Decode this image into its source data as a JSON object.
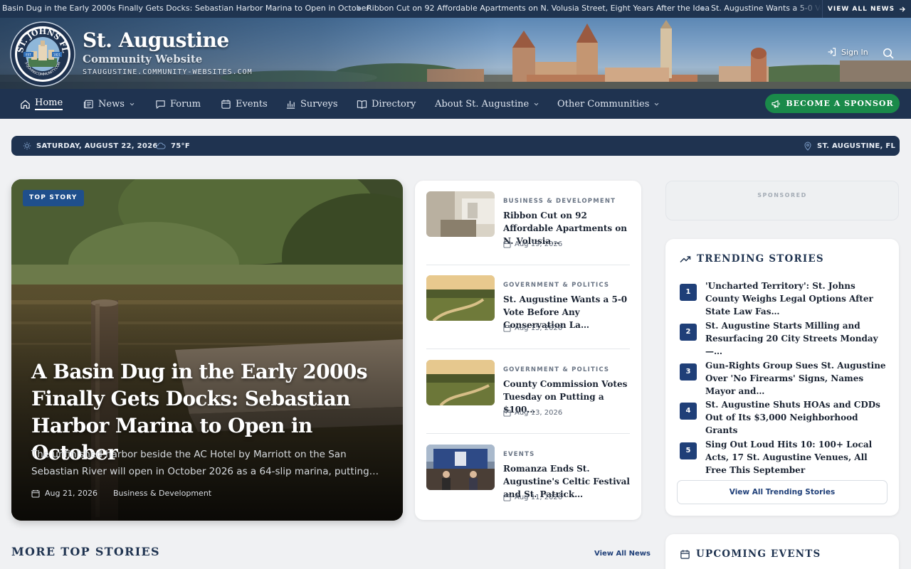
{
  "ticker": {
    "items": [
      "Basin Dug in the Early 2000s Finally Gets Docks: Sebastian Harbor Marina to Open in October",
      "Ribbon Cut on 92 Affordable Apartments on N. Volusia Street, Eight Years After the Idea",
      "St. Augustine Wants a 5-0 Vote Before Any Conservation Land Deal"
    ],
    "view_all": "VIEW ALL NEWS"
  },
  "header": {
    "title": "St. Augustine",
    "subtitle": "Community Website",
    "url": "STAUGUSTINE.COMMUNITY-WEBSITES.COM",
    "logo_text": "ST. JOHNS FL",
    "logo_bottom": "STJOHNSCOMMUNITY.COM",
    "logo_left": "EST",
    "logo_right": "1821",
    "sign_in": "Sign In"
  },
  "nav": {
    "items": [
      {
        "label": "Home",
        "icon": "home-icon"
      },
      {
        "label": "News",
        "icon": "newspaper-icon"
      },
      {
        "label": "Forum",
        "icon": "chat-icon"
      },
      {
        "label": "Events",
        "icon": "calendar-icon"
      },
      {
        "label": "Surveys",
        "icon": "bar-chart-icon"
      },
      {
        "label": "Directory",
        "icon": "book-icon"
      },
      {
        "label": "About St. Augustine"
      },
      {
        "label": "Other Communities"
      }
    ],
    "sponsor": "BECOME A SPONSOR"
  },
  "infobar": {
    "date": "SATURDAY, AUGUST 22, 2026",
    "temp": "75°F",
    "location": "ST. AUGUSTINE, FL"
  },
  "hero": {
    "badge": "TOP STORY",
    "title": "A Basin Dug in the Early 2000s Finally Gets Docks: Sebastian Harbor Marina to Open in October",
    "desc": "The unfinished harbor beside the AC Hotel by Marriott on the San Sebastian River will open in October 2026 as a 64-slip marina, putting…",
    "date": "Aug 21, 2026",
    "category": "Business & Development"
  },
  "stories": [
    {
      "category": "BUSINESS & DEVELOPMENT",
      "title": "Ribbon Cut on 92 Affordable Apartments on N. Volusia…",
      "date": "Aug 19, 2026"
    },
    {
      "category": "GOVERNMENT & POLITICS",
      "title": "St. Augustine Wants a 5-0 Vote Before Any Conservation La…",
      "date": "Aug 15, 2026"
    },
    {
      "category": "GOVERNMENT & POLITICS",
      "title": "County Commission Votes Tuesday on Putting a $100…",
      "date": "Aug 13, 2026"
    },
    {
      "category": "EVENTS",
      "title": "Romanza Ends St. Augustine's Celtic Festival and St. Patrick…",
      "date": "Aug 11, 2026"
    }
  ],
  "sponsored": "SPONSORED",
  "trending": {
    "heading": "TRENDING STORIES",
    "items": [
      {
        "num": "1",
        "title": "'Uncharted Territory': St. Johns County Weighs Legal Options After State Law Fas…"
      },
      {
        "num": "2",
        "title": "St. Augustine Starts Milling and Resurfacing 20 City Streets Monday —…"
      },
      {
        "num": "3",
        "title": "Gun-Rights Group Sues St. Augustine Over 'No Firearms' Signs, Names Mayor and…"
      },
      {
        "num": "4",
        "title": "St. Augustine Shuts HOAs and CDDs Out of Its $3,000 Neighborhood Grants"
      },
      {
        "num": "5",
        "title": "Sing Out Loud Hits 10: 100+ Local Acts, 17 St. Augustine Venues, All Free This September"
      }
    ],
    "view_all": "View All Trending Stories"
  },
  "events": {
    "heading": "UPCOMING EVENTS"
  },
  "more": {
    "heading": "MORE TOP STORIES",
    "view_all": "View All News"
  },
  "colors": {
    "navy": "#1f3350",
    "accent": "#1f3f78",
    "sponsor_green": "#1a8a4a"
  }
}
